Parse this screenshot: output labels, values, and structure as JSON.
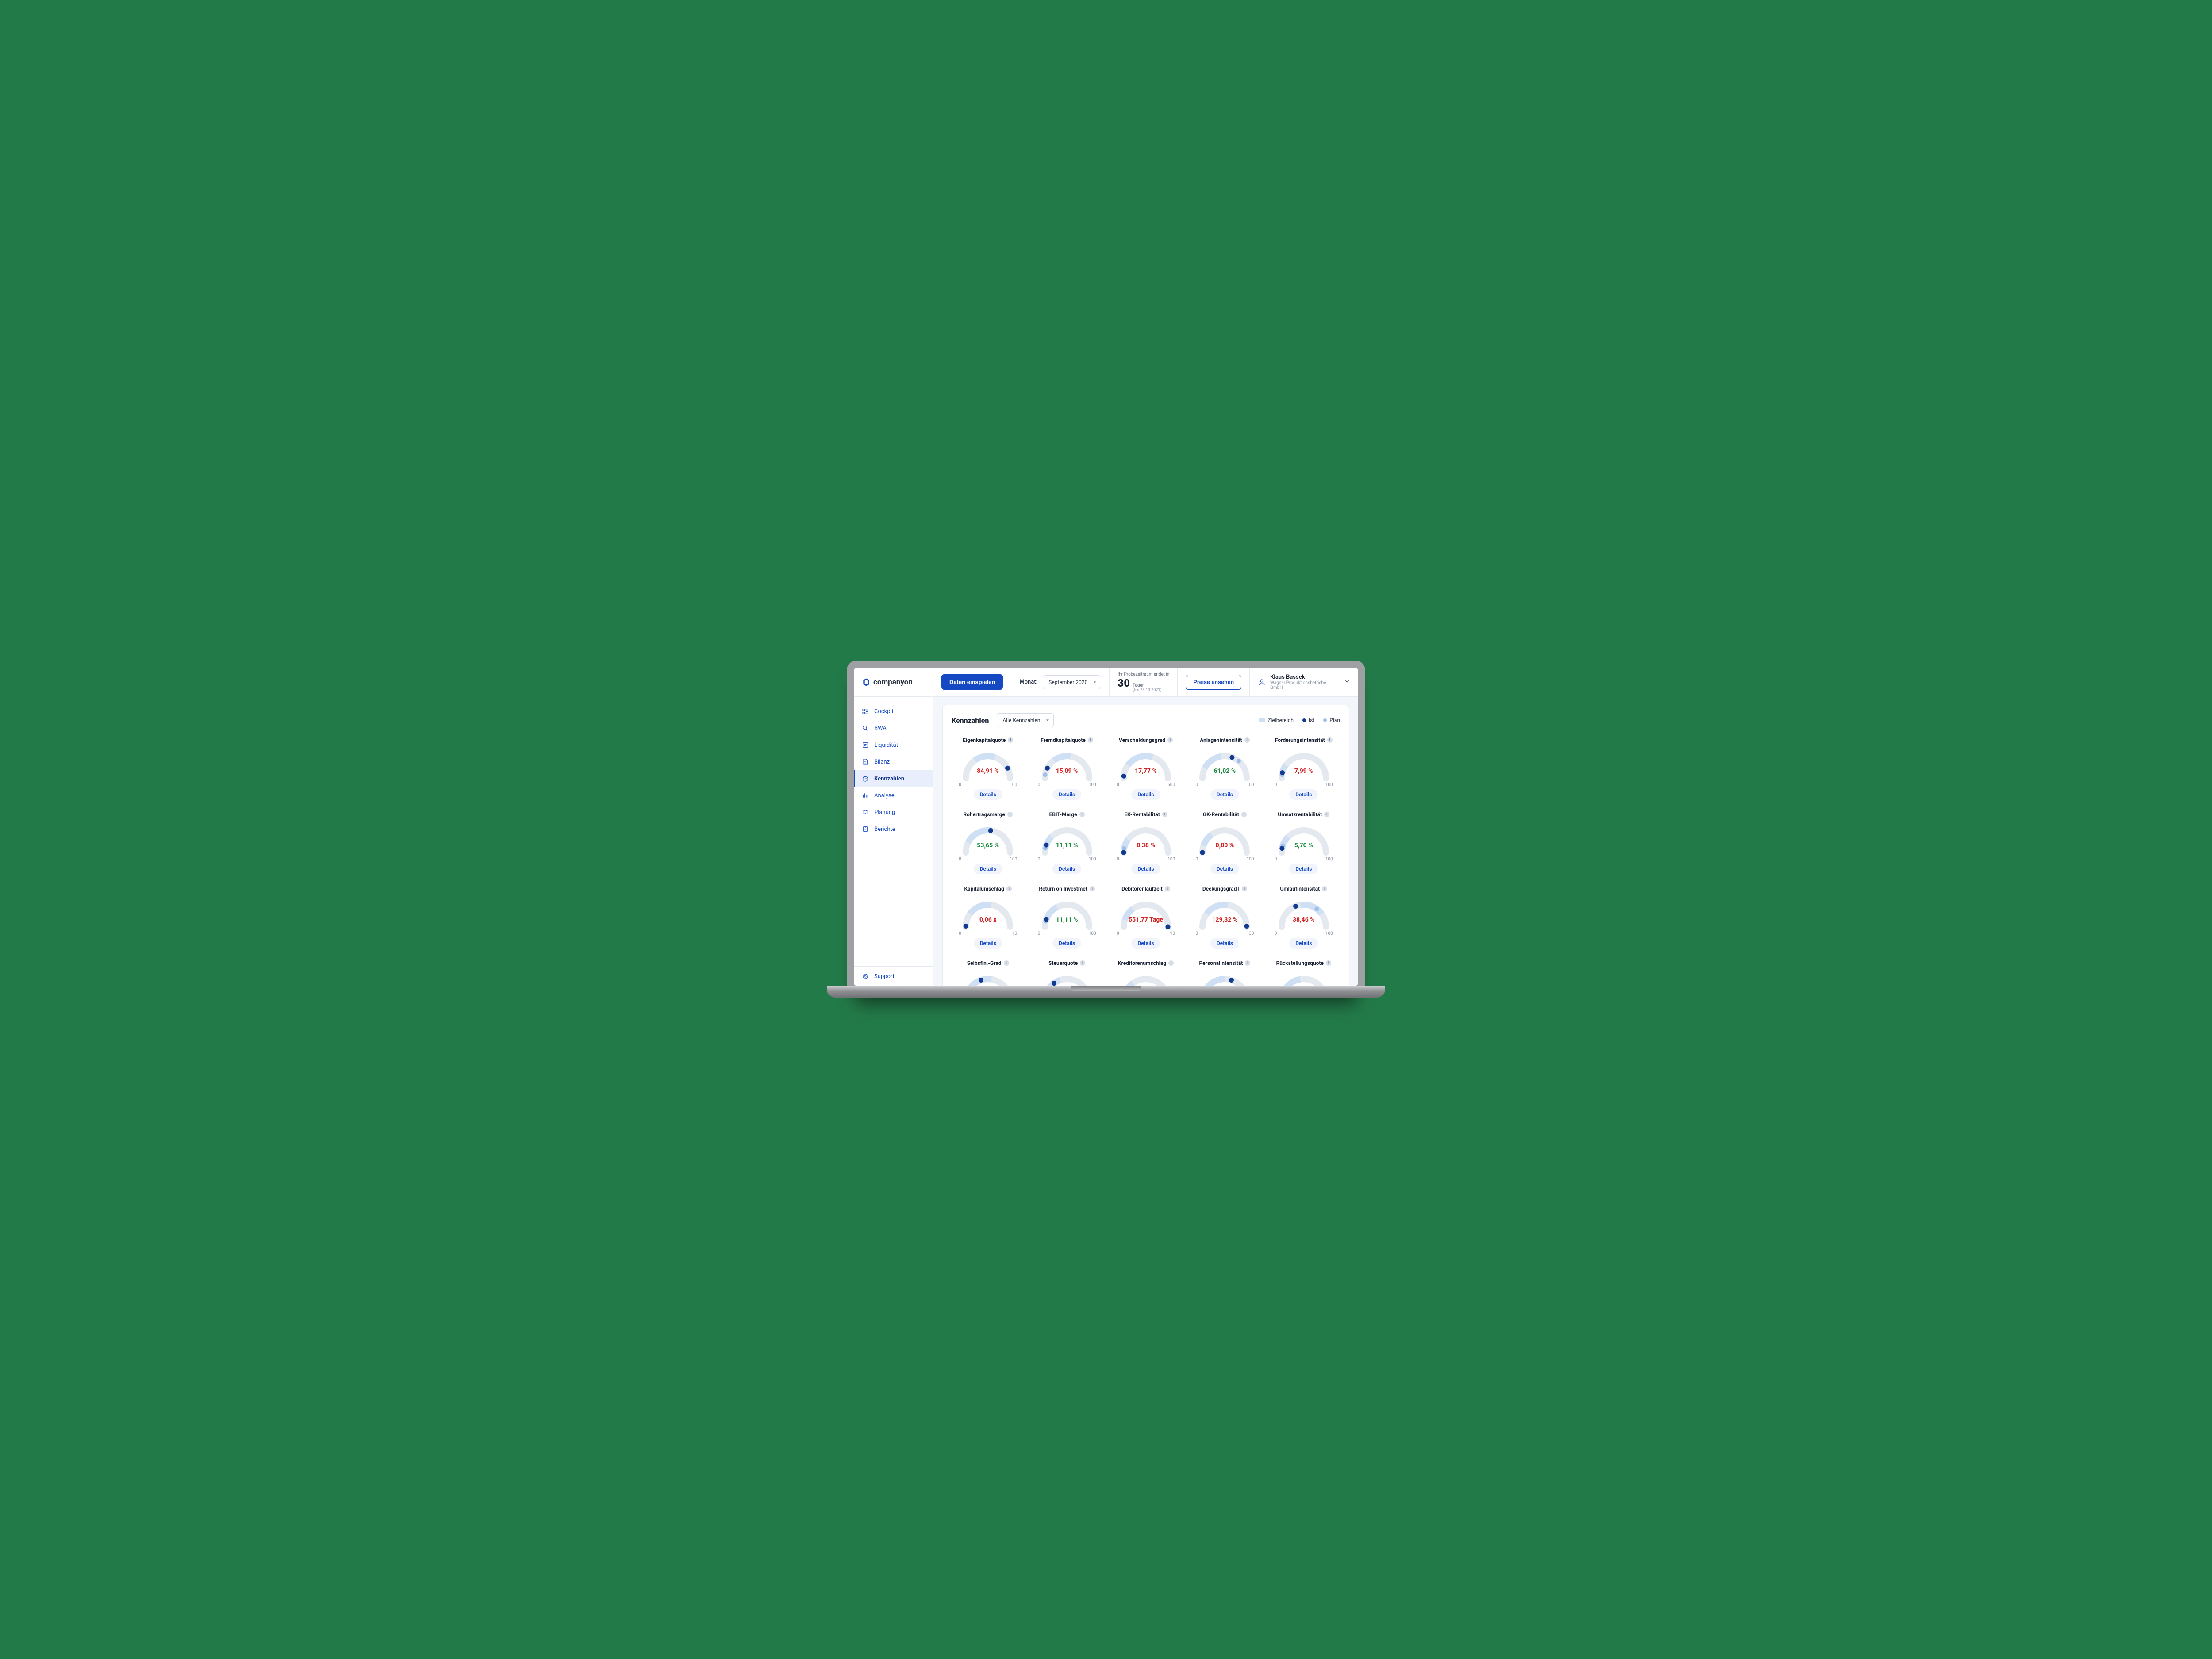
{
  "brand": "companyon",
  "header": {
    "import_button": "Daten einspielen",
    "month_label": "Monat:",
    "month_value": "September 2020",
    "trial_line1": "Ihr Probezeitraum endet in",
    "trial_days": "30",
    "trial_days_unit": "Tagen",
    "trial_until": "(bis 23.10.2021)",
    "pricing_button": "Preise ansehen",
    "user_name": "Klaus Bassek",
    "user_company": "Wagner Produktionsbetriebe GmbH"
  },
  "sidebar": {
    "items": [
      {
        "label": "Cockpit"
      },
      {
        "label": "BWA"
      },
      {
        "label": "Liquidität"
      },
      {
        "label": "Bilanz"
      },
      {
        "label": "Kennzahlen"
      },
      {
        "label": "Analyse"
      },
      {
        "label": "Planung"
      },
      {
        "label": "Berichte"
      }
    ],
    "active_index": 4,
    "support": "Support"
  },
  "panel": {
    "title": "Kennzahlen",
    "filter_value": "Alle Kennzahlen",
    "legend": {
      "ziel": "Zielbereich",
      "ist": "Ist",
      "plan": "Plan"
    },
    "details_label": "Details"
  },
  "kpis": [
    {
      "title": "Eigenkapitalquote",
      "value": "84,91 %",
      "color": "red",
      "min": "0",
      "max": "100",
      "ist": 85,
      "plan": null,
      "ziel": [
        30,
        60
      ]
    },
    {
      "title": "Fremdkapitalquote",
      "value": "15,09 %",
      "color": "red",
      "min": "0",
      "max": "100",
      "ist": 15,
      "plan": 5,
      "ziel": [
        30,
        55
      ]
    },
    {
      "title": "Verschuldungsgrad",
      "value": "17,77 %",
      "color": "red",
      "min": "0",
      "max": "500",
      "ist": 3,
      "plan": null,
      "ziel": [
        20,
        60
      ]
    },
    {
      "title": "Anlagenintensität",
      "value": "61,02 %",
      "color": "green",
      "min": "0",
      "max": "100",
      "ist": 61,
      "plan": 72,
      "ziel": [
        15,
        45
      ]
    },
    {
      "title": "Forderungsintensität",
      "value": "7,99 %",
      "color": "red",
      "min": "0",
      "max": "100",
      "ist": 8,
      "plan": 5,
      "ziel": [
        10,
        20
      ]
    },
    {
      "title": "Rohertragsmarge",
      "value": "53,65 %",
      "color": "green",
      "min": "0",
      "max": "100",
      "ist": 54,
      "plan": null,
      "ziel": [
        15,
        55
      ]
    },
    {
      "title": "EBIT-Marge",
      "value": "11,11 %",
      "color": "green",
      "min": "0",
      "max": "100",
      "ist": 11,
      "plan": 6,
      "ziel": [
        5,
        25
      ]
    },
    {
      "title": "EK-Rentabilität",
      "value": "0,38 %",
      "color": "red",
      "min": "0",
      "max": "100",
      "ist": 0,
      "plan": 6,
      "ziel": [
        5,
        20
      ]
    },
    {
      "title": "GK-Rentabilität",
      "value": "0,00 %",
      "color": "red",
      "min": "0",
      "max": "100",
      "ist": 0,
      "plan": null,
      "ziel": [
        10,
        30
      ]
    },
    {
      "title": "Umsatzrentabilität",
      "value": "5,70 %",
      "color": "green",
      "min": "0",
      "max": "100",
      "ist": 6,
      "plan": 10,
      "ziel": [
        5,
        25
      ]
    },
    {
      "title": "Kapitalumschlag",
      "value": "0,06 x",
      "color": "red",
      "min": "0",
      "max": "10",
      "ist": 1,
      "plan": null,
      "ziel": [
        20,
        55
      ]
    },
    {
      "title": "Return on Investmet",
      "value": "11,11 %",
      "color": "green",
      "min": "0",
      "max": "100",
      "ist": 11,
      "plan": 8,
      "ziel": [
        10,
        35
      ]
    },
    {
      "title": "Debitorenlaufzeit",
      "value": "551,77 Tage",
      "color": "red",
      "min": "0",
      "max": "90",
      "ist": 100,
      "plan": null,
      "ziel": [
        10,
        30
      ]
    },
    {
      "title": "Deckungsgrad I",
      "value": "129,32 %",
      "color": "red",
      "min": "0",
      "max": "130",
      "ist": 99,
      "plan": null,
      "ziel": [
        20,
        55
      ]
    },
    {
      "title": "Umlaufintensität",
      "value": "38,46 %",
      "color": "red",
      "min": "0",
      "max": "100",
      "ist": 38,
      "plan": 70,
      "ziel": [
        45,
        80
      ]
    },
    {
      "title": "Selbsfin.-Grad",
      "value": "",
      "color": "green",
      "min": "0",
      "max": "100",
      "ist": 40,
      "plan": null,
      "ziel": [
        15,
        55
      ],
      "partial": true
    },
    {
      "title": "Steuerquote",
      "value": "",
      "color": "green",
      "min": "0",
      "max": "100",
      "ist": 30,
      "plan": null,
      "ziel": [
        10,
        40
      ],
      "partial": true
    },
    {
      "title": "Kreditorenumschlag",
      "value": "",
      "color": "red",
      "min": "0",
      "max": "100",
      "ist": null,
      "plan": null,
      "ziel": [
        10,
        30
      ],
      "partial": true
    },
    {
      "title": "Personalintensität",
      "value": "",
      "color": "red",
      "min": "0",
      "max": "100",
      "ist": 60,
      "plan": null,
      "ziel": [
        20,
        50
      ],
      "partial": true
    },
    {
      "title": "Rückstellungsquote",
      "value": "",
      "color": "red",
      "min": "0",
      "max": "100",
      "ist": null,
      "plan": null,
      "ziel": [
        15,
        45
      ],
      "partial": true
    }
  ],
  "chart_data": {
    "type": "gauge-grid",
    "note": "Semicircular KPI gauges; percentages 0-100 unless max shown. 'ist' = actual dot position (% of scale), 'plan' = plan dot, 'ziel' = target range start/end (% of scale).",
    "gauges": [
      {
        "label": "Eigenkapitalquote",
        "value": 84.91,
        "unit": "%",
        "range": [
          0,
          100
        ],
        "target_range_pct": [
          30,
          60
        ],
        "ist_pct": 85
      },
      {
        "label": "Fremdkapitalquote",
        "value": 15.09,
        "unit": "%",
        "range": [
          0,
          100
        ],
        "target_range_pct": [
          30,
          55
        ],
        "ist_pct": 15,
        "plan_pct": 5
      },
      {
        "label": "Verschuldungsgrad",
        "value": 17.77,
        "unit": "%",
        "range": [
          0,
          500
        ],
        "target_range_pct": [
          20,
          60
        ],
        "ist_pct": 3
      },
      {
        "label": "Anlagenintensität",
        "value": 61.02,
        "unit": "%",
        "range": [
          0,
          100
        ],
        "target_range_pct": [
          15,
          45
        ],
        "ist_pct": 61,
        "plan_pct": 72
      },
      {
        "label": "Forderungsintensität",
        "value": 7.99,
        "unit": "%",
        "range": [
          0,
          100
        ],
        "target_range_pct": [
          10,
          20
        ],
        "ist_pct": 8,
        "plan_pct": 5
      },
      {
        "label": "Rohertragsmarge",
        "value": 53.65,
        "unit": "%",
        "range": [
          0,
          100
        ],
        "target_range_pct": [
          15,
          55
        ],
        "ist_pct": 54
      },
      {
        "label": "EBIT-Marge",
        "value": 11.11,
        "unit": "%",
        "range": [
          0,
          100
        ],
        "target_range_pct": [
          5,
          25
        ],
        "ist_pct": 11,
        "plan_pct": 6
      },
      {
        "label": "EK-Rentabilität",
        "value": 0.38,
        "unit": "%",
        "range": [
          0,
          100
        ],
        "target_range_pct": [
          5,
          20
        ],
        "ist_pct": 0,
        "plan_pct": 6
      },
      {
        "label": "GK-Rentabilität",
        "value": 0.0,
        "unit": "%",
        "range": [
          0,
          100
        ],
        "target_range_pct": [
          10,
          30
        ],
        "ist_pct": 0
      },
      {
        "label": "Umsatzrentabilität",
        "value": 5.7,
        "unit": "%",
        "range": [
          0,
          100
        ],
        "target_range_pct": [
          5,
          25
        ],
        "ist_pct": 6,
        "plan_pct": 10
      },
      {
        "label": "Kapitalumschlag",
        "value": 0.06,
        "unit": "x",
        "range": [
          0,
          10
        ],
        "target_range_pct": [
          20,
          55
        ],
        "ist_pct": 1
      },
      {
        "label": "Return on Investmet",
        "value": 11.11,
        "unit": "%",
        "range": [
          0,
          100
        ],
        "target_range_pct": [
          10,
          35
        ],
        "ist_pct": 11,
        "plan_pct": 8
      },
      {
        "label": "Debitorenlaufzeit",
        "value": 551.77,
        "unit": "Tage",
        "range": [
          0,
          90
        ],
        "target_range_pct": [
          10,
          30
        ],
        "ist_pct": 100
      },
      {
        "label": "Deckungsgrad I",
        "value": 129.32,
        "unit": "%",
        "range": [
          0,
          130
        ],
        "target_range_pct": [
          20,
          55
        ],
        "ist_pct": 99
      },
      {
        "label": "Umlaufintensität",
        "value": 38.46,
        "unit": "%",
        "range": [
          0,
          100
        ],
        "target_range_pct": [
          45,
          80
        ],
        "ist_pct": 38,
        "plan_pct": 70
      }
    ]
  }
}
